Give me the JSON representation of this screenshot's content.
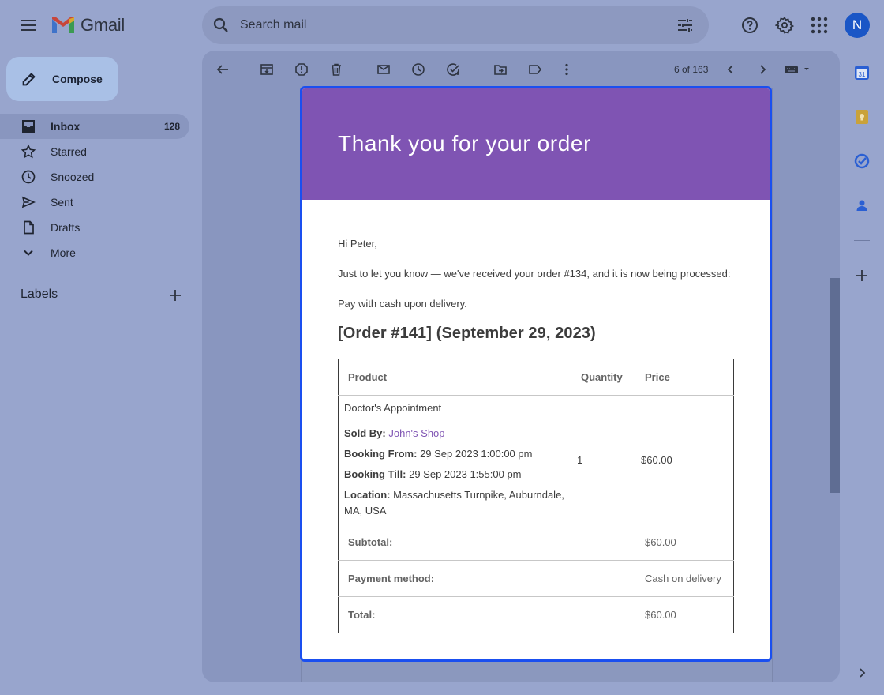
{
  "app": {
    "name": "Gmail"
  },
  "search": {
    "placeholder": "Search mail"
  },
  "account": {
    "initial": "N",
    "color": "#1a56c6"
  },
  "sidebar": {
    "compose_label": "Compose",
    "items": [
      {
        "label": "Inbox",
        "count": "128",
        "icon": "inbox-icon",
        "active": true
      },
      {
        "label": "Starred",
        "icon": "star-icon"
      },
      {
        "label": "Snoozed",
        "icon": "clock-icon"
      },
      {
        "label": "Sent",
        "icon": "send-icon"
      },
      {
        "label": "Drafts",
        "icon": "draft-icon"
      },
      {
        "label": "More",
        "icon": "chevron-down-icon"
      }
    ],
    "labels_heading": "Labels"
  },
  "toolbar": {
    "icons": [
      "back-arrow-icon",
      "archive-icon",
      "report-spam-icon",
      "delete-icon",
      "mark-unread-icon",
      "snooze-icon",
      "add-task-icon",
      "move-to-icon",
      "label-icon",
      "more-vert-icon"
    ],
    "counter": "6 of 163"
  },
  "email": {
    "banner_title": "Thank you for your order",
    "banner_color": "#7f54b3",
    "greeting": "Hi Peter,",
    "intro": "Just to let you know — we've received your order #134, and it is now being processed:",
    "payment_note": "Pay with cash upon delivery.",
    "order_heading": "[Order #141] (September 29, 2023)",
    "table": {
      "headers": [
        "Product",
        "Quantity",
        "Price"
      ],
      "item": {
        "name": "Doctor's Appointment",
        "sold_by_label": "Sold By:",
        "sold_by_value": "John's Shop",
        "booking_from_label": "Booking From:",
        "booking_from_value": "29 Sep 2023 1:00:00 pm",
        "booking_till_label": "Booking Till:",
        "booking_till_value": "29 Sep 2023 1:55:00 pm",
        "location_label": "Location:",
        "location_value": "Massachusetts Turnpike, Auburndale, MA, USA",
        "quantity": "1",
        "price": "$60.00"
      },
      "totals": [
        {
          "label": "Subtotal:",
          "value": "$60.00"
        },
        {
          "label": "Payment method:",
          "value": "Cash on delivery"
        },
        {
          "label": "Total:",
          "value": "$60.00"
        }
      ]
    }
  },
  "right_rail": {
    "icons": [
      "calendar-icon",
      "keep-icon",
      "tasks-icon",
      "contacts-icon",
      "add-icon",
      "expand-icon"
    ]
  }
}
